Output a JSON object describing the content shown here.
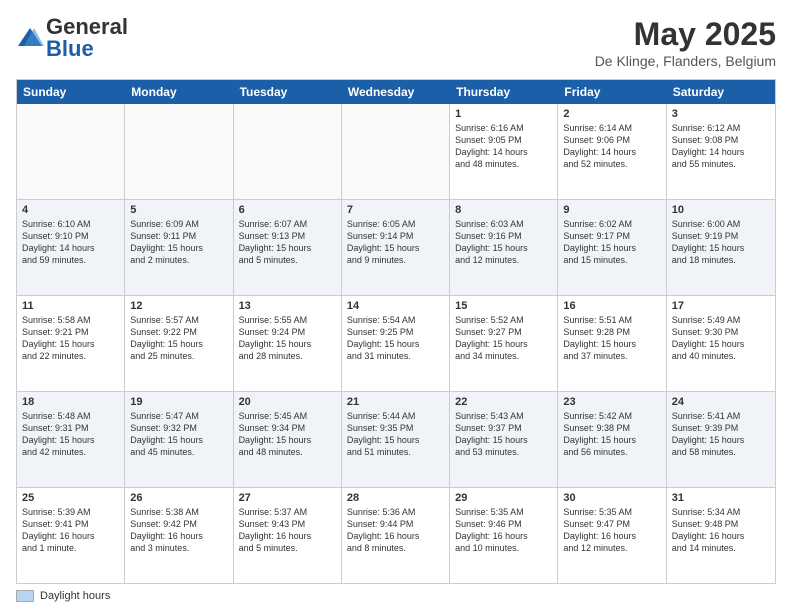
{
  "logo": {
    "general": "General",
    "blue": "Blue"
  },
  "header": {
    "title": "May 2025",
    "subtitle": "De Klinge, Flanders, Belgium"
  },
  "weekdays": [
    "Sunday",
    "Monday",
    "Tuesday",
    "Wednesday",
    "Thursday",
    "Friday",
    "Saturday"
  ],
  "legend": {
    "label": "Daylight hours"
  },
  "rows": [
    {
      "alt": false,
      "cells": [
        {
          "day": "",
          "info": ""
        },
        {
          "day": "",
          "info": ""
        },
        {
          "day": "",
          "info": ""
        },
        {
          "day": "",
          "info": ""
        },
        {
          "day": "1",
          "info": "Sunrise: 6:16 AM\nSunset: 9:05 PM\nDaylight: 14 hours\nand 48 minutes."
        },
        {
          "day": "2",
          "info": "Sunrise: 6:14 AM\nSunset: 9:06 PM\nDaylight: 14 hours\nand 52 minutes."
        },
        {
          "day": "3",
          "info": "Sunrise: 6:12 AM\nSunset: 9:08 PM\nDaylight: 14 hours\nand 55 minutes."
        }
      ]
    },
    {
      "alt": true,
      "cells": [
        {
          "day": "4",
          "info": "Sunrise: 6:10 AM\nSunset: 9:10 PM\nDaylight: 14 hours\nand 59 minutes."
        },
        {
          "day": "5",
          "info": "Sunrise: 6:09 AM\nSunset: 9:11 PM\nDaylight: 15 hours\nand 2 minutes."
        },
        {
          "day": "6",
          "info": "Sunrise: 6:07 AM\nSunset: 9:13 PM\nDaylight: 15 hours\nand 5 minutes."
        },
        {
          "day": "7",
          "info": "Sunrise: 6:05 AM\nSunset: 9:14 PM\nDaylight: 15 hours\nand 9 minutes."
        },
        {
          "day": "8",
          "info": "Sunrise: 6:03 AM\nSunset: 9:16 PM\nDaylight: 15 hours\nand 12 minutes."
        },
        {
          "day": "9",
          "info": "Sunrise: 6:02 AM\nSunset: 9:17 PM\nDaylight: 15 hours\nand 15 minutes."
        },
        {
          "day": "10",
          "info": "Sunrise: 6:00 AM\nSunset: 9:19 PM\nDaylight: 15 hours\nand 18 minutes."
        }
      ]
    },
    {
      "alt": false,
      "cells": [
        {
          "day": "11",
          "info": "Sunrise: 5:58 AM\nSunset: 9:21 PM\nDaylight: 15 hours\nand 22 minutes."
        },
        {
          "day": "12",
          "info": "Sunrise: 5:57 AM\nSunset: 9:22 PM\nDaylight: 15 hours\nand 25 minutes."
        },
        {
          "day": "13",
          "info": "Sunrise: 5:55 AM\nSunset: 9:24 PM\nDaylight: 15 hours\nand 28 minutes."
        },
        {
          "day": "14",
          "info": "Sunrise: 5:54 AM\nSunset: 9:25 PM\nDaylight: 15 hours\nand 31 minutes."
        },
        {
          "day": "15",
          "info": "Sunrise: 5:52 AM\nSunset: 9:27 PM\nDaylight: 15 hours\nand 34 minutes."
        },
        {
          "day": "16",
          "info": "Sunrise: 5:51 AM\nSunset: 9:28 PM\nDaylight: 15 hours\nand 37 minutes."
        },
        {
          "day": "17",
          "info": "Sunrise: 5:49 AM\nSunset: 9:30 PM\nDaylight: 15 hours\nand 40 minutes."
        }
      ]
    },
    {
      "alt": true,
      "cells": [
        {
          "day": "18",
          "info": "Sunrise: 5:48 AM\nSunset: 9:31 PM\nDaylight: 15 hours\nand 42 minutes."
        },
        {
          "day": "19",
          "info": "Sunrise: 5:47 AM\nSunset: 9:32 PM\nDaylight: 15 hours\nand 45 minutes."
        },
        {
          "day": "20",
          "info": "Sunrise: 5:45 AM\nSunset: 9:34 PM\nDaylight: 15 hours\nand 48 minutes."
        },
        {
          "day": "21",
          "info": "Sunrise: 5:44 AM\nSunset: 9:35 PM\nDaylight: 15 hours\nand 51 minutes."
        },
        {
          "day": "22",
          "info": "Sunrise: 5:43 AM\nSunset: 9:37 PM\nDaylight: 15 hours\nand 53 minutes."
        },
        {
          "day": "23",
          "info": "Sunrise: 5:42 AM\nSunset: 9:38 PM\nDaylight: 15 hours\nand 56 minutes."
        },
        {
          "day": "24",
          "info": "Sunrise: 5:41 AM\nSunset: 9:39 PM\nDaylight: 15 hours\nand 58 minutes."
        }
      ]
    },
    {
      "alt": false,
      "cells": [
        {
          "day": "25",
          "info": "Sunrise: 5:39 AM\nSunset: 9:41 PM\nDaylight: 16 hours\nand 1 minute."
        },
        {
          "day": "26",
          "info": "Sunrise: 5:38 AM\nSunset: 9:42 PM\nDaylight: 16 hours\nand 3 minutes."
        },
        {
          "day": "27",
          "info": "Sunrise: 5:37 AM\nSunset: 9:43 PM\nDaylight: 16 hours\nand 5 minutes."
        },
        {
          "day": "28",
          "info": "Sunrise: 5:36 AM\nSunset: 9:44 PM\nDaylight: 16 hours\nand 8 minutes."
        },
        {
          "day": "29",
          "info": "Sunrise: 5:35 AM\nSunset: 9:46 PM\nDaylight: 16 hours\nand 10 minutes."
        },
        {
          "day": "30",
          "info": "Sunrise: 5:35 AM\nSunset: 9:47 PM\nDaylight: 16 hours\nand 12 minutes."
        },
        {
          "day": "31",
          "info": "Sunrise: 5:34 AM\nSunset: 9:48 PM\nDaylight: 16 hours\nand 14 minutes."
        }
      ]
    }
  ]
}
